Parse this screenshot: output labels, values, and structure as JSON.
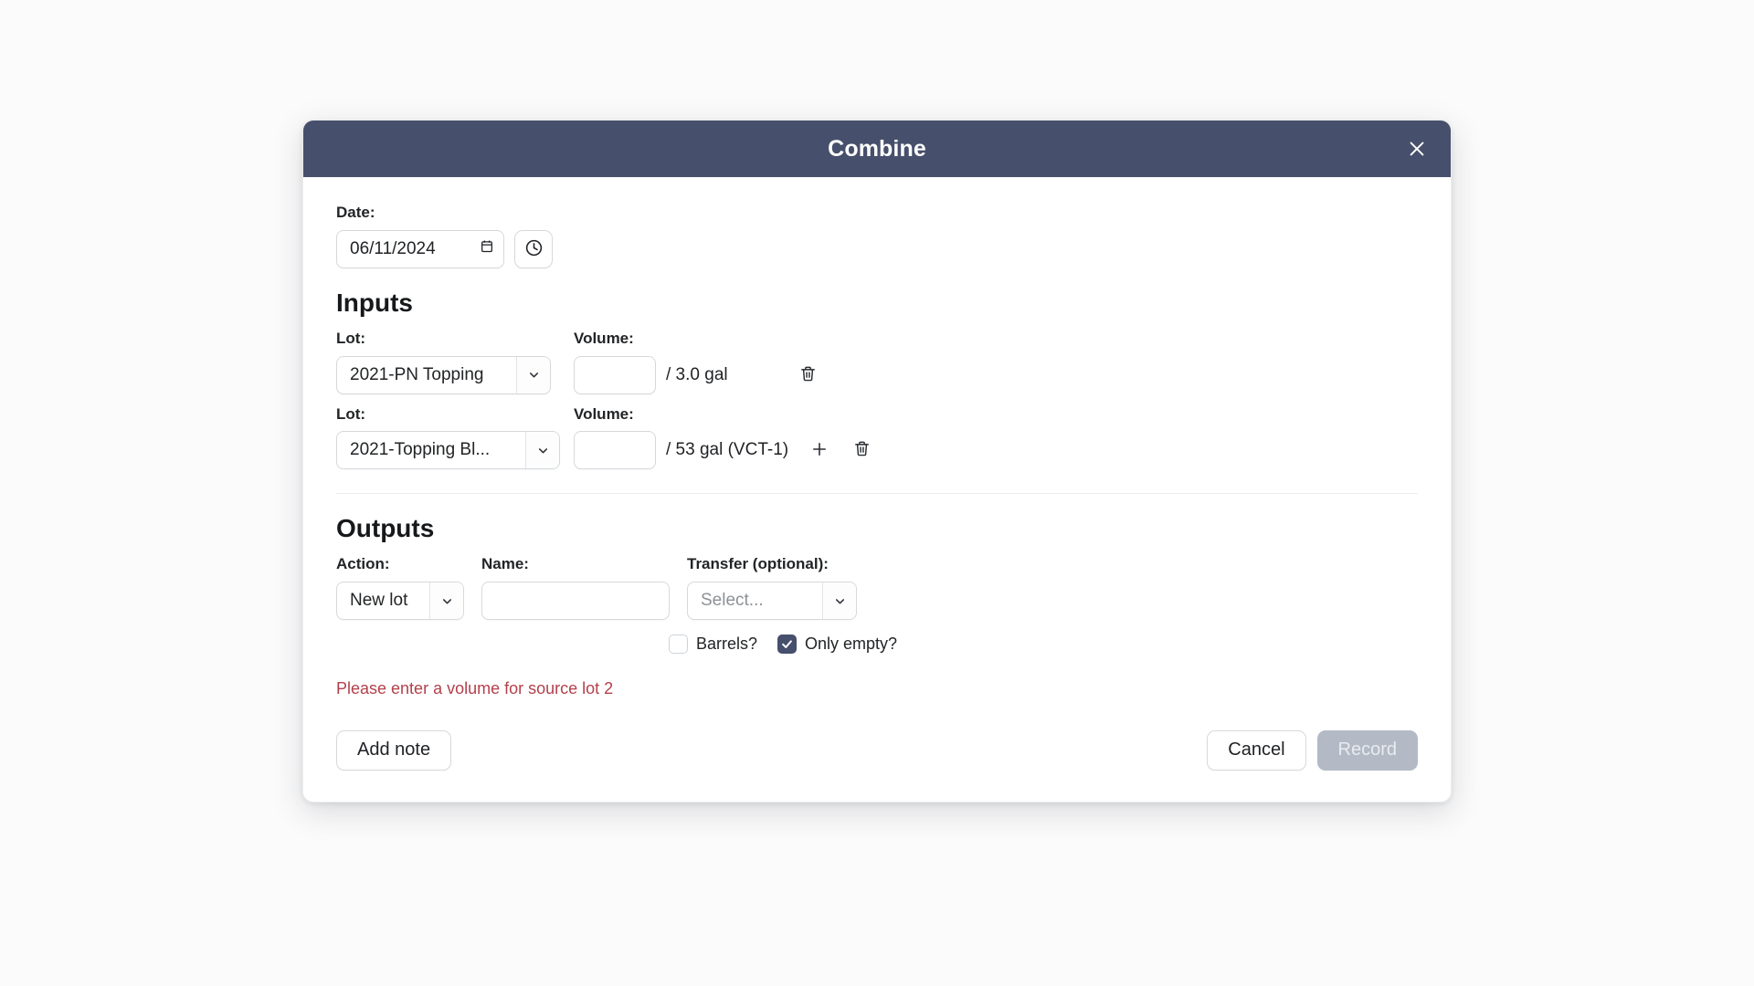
{
  "modal": {
    "title": "Combine",
    "close_icon": "close-icon"
  },
  "date_section": {
    "label": "Date:",
    "value": "06/11/2024",
    "calendar_icon": "calendar-icon",
    "clock_icon": "clock-icon"
  },
  "inputs": {
    "heading": "Inputs",
    "lot_label": "Lot:",
    "volume_label": "Volume:",
    "rows": [
      {
        "lot": "2021-PN Topping",
        "volume_value": "",
        "capacity": "/ 3.0 gal",
        "has_add": false,
        "delete_icon": "trash-icon"
      },
      {
        "lot": "2021-Topping Bl...",
        "volume_value": "",
        "capacity": "/ 53 gal (VCT-1)",
        "has_add": true,
        "add_icon": "plus-icon",
        "delete_icon": "trash-icon"
      }
    ]
  },
  "outputs": {
    "heading": "Outputs",
    "action_label": "Action:",
    "action_value": "New lot",
    "name_label": "Name:",
    "name_value": "",
    "transfer_label": "Transfer (optional):",
    "transfer_placeholder": "Select...",
    "checkboxes": [
      {
        "label": "Barrels?",
        "checked": false
      },
      {
        "label": "Only empty?",
        "checked": true
      }
    ]
  },
  "error": {
    "message": "Please enter a volume for source lot 2",
    "color": "#b3404b"
  },
  "footer": {
    "add_note_label": "Add note",
    "cancel_label": "Cancel",
    "record_label": "Record",
    "record_disabled": true
  },
  "colors": {
    "header_bg": "#464f6b",
    "checkbox_on": "#46506d",
    "disabled_btn": "#b3bac6",
    "page_bg": "#fbfbfb"
  }
}
